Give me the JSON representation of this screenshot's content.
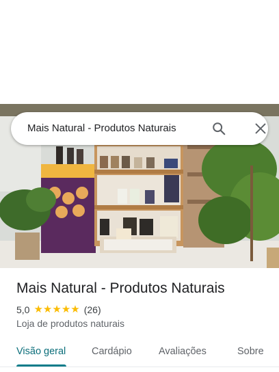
{
  "search": {
    "query": "Mais Natural - Produtos Naturais"
  },
  "icons": {
    "search": "search-icon",
    "close": "close-icon",
    "star": "star-icon"
  },
  "place": {
    "name": "Mais Natural - Produtos Naturais",
    "rating": "5,0",
    "stars": 5,
    "review_count": "(26)",
    "category": "Loja de produtos naturais"
  },
  "tabs": [
    {
      "label": "Visão geral",
      "active": true
    },
    {
      "label": "Cardápio",
      "active": false
    },
    {
      "label": "Avaliações",
      "active": false
    },
    {
      "label": "Sobre",
      "active": false
    }
  ],
  "colors": {
    "accent": "#0b7c8a",
    "star": "#fbbc04"
  }
}
